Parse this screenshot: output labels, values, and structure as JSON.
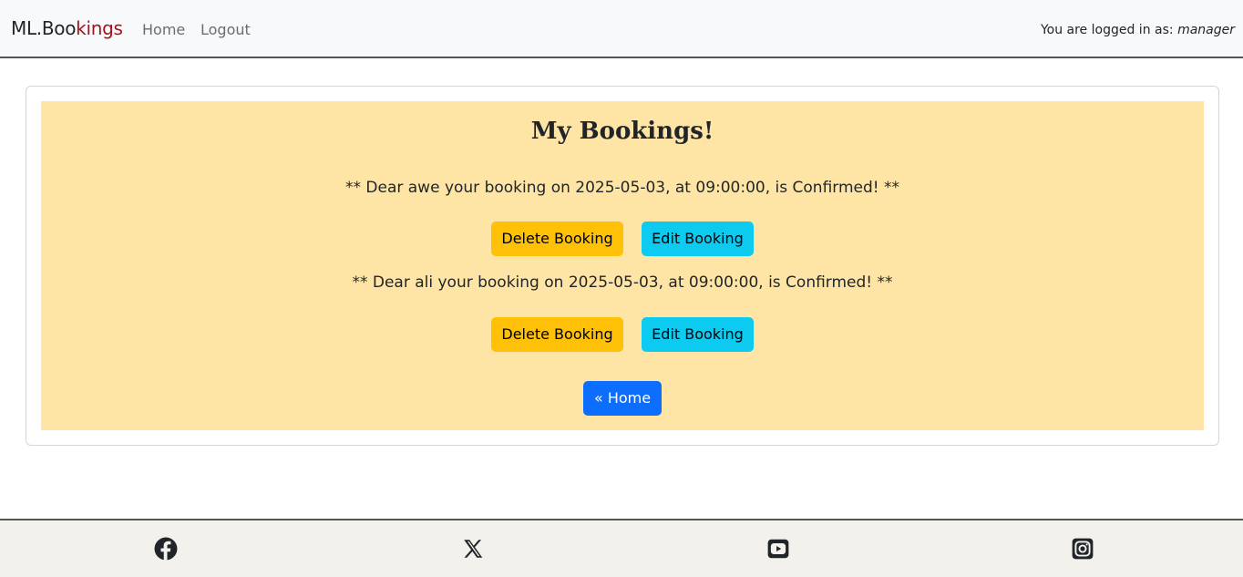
{
  "navbar": {
    "brand_part1": "ML.Boo",
    "brand_part2": "kings",
    "home_label": "Home",
    "logout_label": "Logout",
    "login_prefix": "You are logged in as:",
    "username": "manager"
  },
  "main": {
    "title": "My Bookings!",
    "bookings": [
      {
        "message": "** Dear awe your booking on 2025-05-03, at 09:00:00, is Confirmed! **",
        "delete_label": "Delete Booking",
        "edit_label": "Edit Booking"
      },
      {
        "message": "** Dear ali your booking on 2025-05-03, at 09:00:00, is Confirmed! **",
        "delete_label": "Delete Booking",
        "edit_label": "Edit Booking"
      }
    ],
    "home_button_label": "« Home"
  },
  "footer": {
    "icons": [
      "facebook-icon",
      "x-twitter-icon",
      "youtube-icon",
      "instagram-icon"
    ]
  },
  "colors": {
    "brand_accent": "#a3141c",
    "panel_background": "#ffe5a5",
    "delete_button": "#ffc107",
    "edit_button": "#0dcaf0",
    "home_button": "#0d6efd"
  }
}
